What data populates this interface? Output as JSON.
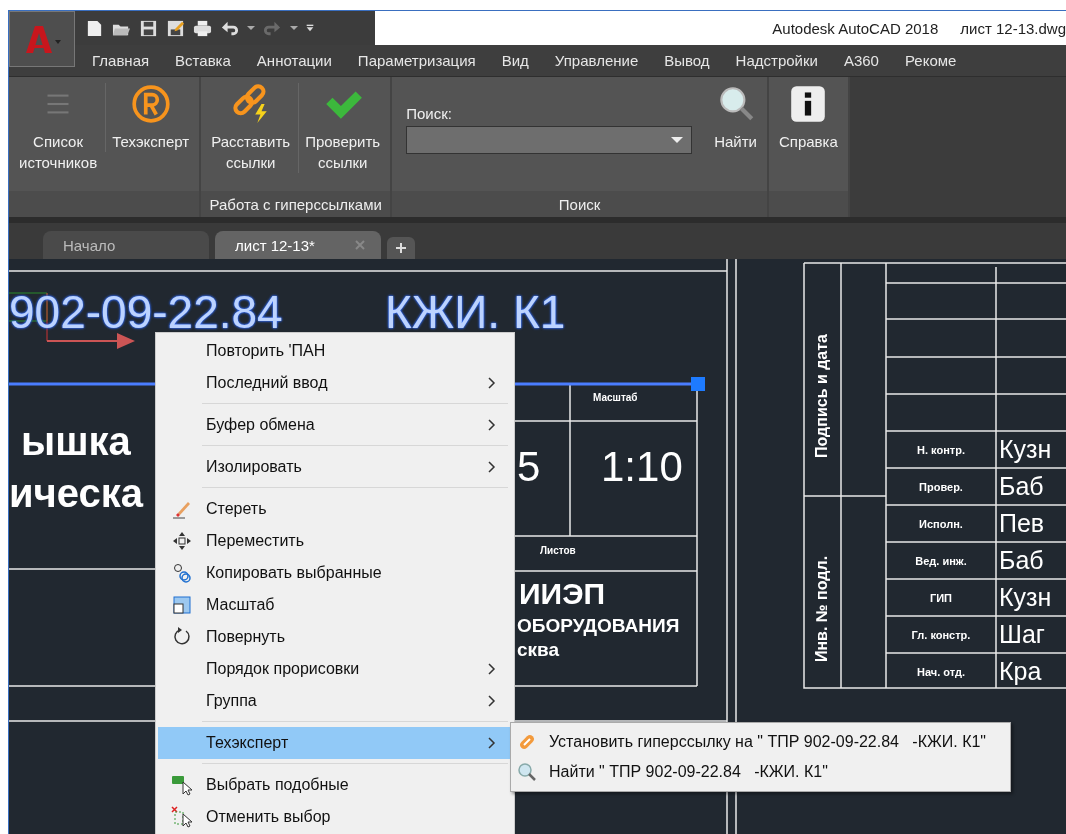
{
  "title_bar": {
    "app_title": "Autodesk AutoCAD 2018",
    "file_name": "лист 12-13.dwg"
  },
  "menu_tabs": [
    "Главная",
    "Вставка",
    "Аннотации",
    "Параметризация",
    "Вид",
    "Управление",
    "Вывод",
    "Надстройки",
    "A360",
    "Рекоме"
  ],
  "ribbon": {
    "panels": [
      {
        "items": [
          {
            "kind": "button",
            "label": "Список\nисточников"
          },
          {
            "kind": "button",
            "label": "Техэксперт"
          }
        ]
      },
      {
        "title": "Работа с гиперссылками",
        "items": [
          {
            "kind": "button",
            "label": "Расставить\nссылки"
          },
          {
            "kind": "button",
            "label": "Проверить\nссылки"
          }
        ]
      },
      {
        "title": "Поиск",
        "items": [
          {
            "kind": "search",
            "label": "Поиск:"
          },
          {
            "kind": "button",
            "label": "Найти"
          }
        ]
      },
      {
        "items": [
          {
            "kind": "button",
            "label": "Справка"
          }
        ]
      }
    ]
  },
  "doc_tabs": [
    {
      "label": "Начало",
      "selected": false,
      "closable": false
    },
    {
      "label": "лист 12-13*",
      "selected": true,
      "closable": true
    }
  ],
  "drawing": {
    "designation": {
      "parts": [
        "902-09-22.84",
        "КЖИ. К1"
      ],
      "selected": true
    },
    "title_fragments": [
      "ышка",
      "ическа"
    ],
    "scale_label": "Масштаб",
    "scale": "1:10",
    "sheet_digit": "5",
    "sheets_label": "Листов",
    "org_lines": [
      "ИИЭП",
      "ОБОРУДОВАНИЯ",
      "сква"
    ],
    "side_labels": [
      "Подпись и дата",
      "Инв. № подл."
    ],
    "signatures": [
      {
        "role": "Н. контр.",
        "name": "Кузн"
      },
      {
        "role": "Провер.",
        "name": "Баб"
      },
      {
        "role": "Исполн.",
        "name": "Пев"
      },
      {
        "role": "Вед. инж.",
        "name": "Баб"
      },
      {
        "role": "ГИП",
        "name": "Кузн"
      },
      {
        "role": "Гл. констр.",
        "name": "Шаг"
      },
      {
        "role": "Нач. отд.",
        "name": "Кра"
      }
    ]
  },
  "context_menu": {
    "items": [
      {
        "kind": "command",
        "label": "Повторить 'ПАН",
        "submenu": false,
        "selected": false
      },
      {
        "kind": "command",
        "label": "Последний ввод",
        "submenu": true,
        "selected": false
      },
      {
        "kind": "separator"
      },
      {
        "kind": "command",
        "label": "Буфер обмена",
        "submenu": true,
        "selected": false
      },
      {
        "kind": "separator"
      },
      {
        "kind": "command",
        "label": "Изолировать",
        "submenu": true,
        "selected": false
      },
      {
        "kind": "separator"
      },
      {
        "kind": "command",
        "label": "Стереть",
        "submenu": false,
        "selected": false
      },
      {
        "kind": "command",
        "label": "Переместить",
        "submenu": false,
        "selected": false
      },
      {
        "kind": "command",
        "label": "Копировать выбранные",
        "submenu": false,
        "selected": false
      },
      {
        "kind": "command",
        "label": "Масштаб",
        "submenu": false,
        "selected": false
      },
      {
        "kind": "command",
        "label": "Повернуть",
        "submenu": false,
        "selected": false
      },
      {
        "kind": "command",
        "label": "Порядок прорисовки",
        "submenu": true,
        "selected": false
      },
      {
        "kind": "command",
        "label": "Группа",
        "submenu": true,
        "selected": false
      },
      {
        "kind": "separator"
      },
      {
        "kind": "command",
        "label": "Техэксперт",
        "submenu": true,
        "selected": true
      },
      {
        "kind": "separator"
      },
      {
        "kind": "command",
        "label": "Выбрать подобные",
        "submenu": false,
        "selected": false
      },
      {
        "kind": "command",
        "label": "Отменить выбор",
        "submenu": false,
        "selected": false
      }
    ]
  },
  "submenu": {
    "items": [
      {
        "label": "Установить гиперссылку на \" ТПР 902-09-22.84   -КЖИ. К1\""
      },
      {
        "label": "Найти \" ТПР 902-09-22.84   -КЖИ. К1\""
      }
    ]
  }
}
